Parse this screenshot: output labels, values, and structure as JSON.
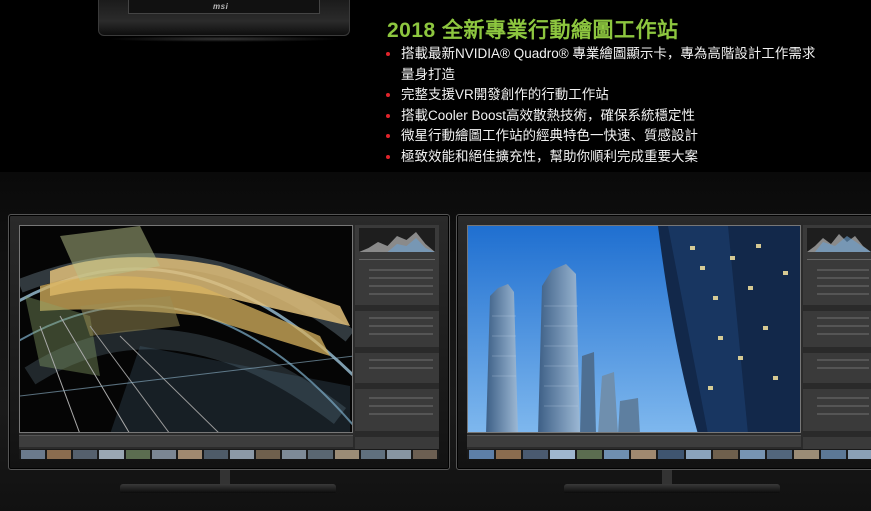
{
  "laptop": {
    "brand": "msi"
  },
  "headline": "2018 全新專業行動繪圖工作站",
  "features": [
    {
      "text": "搭載最新NVIDIA® Quadro® 專業繪圖顯示卡，專為高階設計工作需求量身打造"
    },
    {
      "text": "完整支援VR開發創作的行動工作站"
    },
    {
      "text": "搭載Cooler Boost高效散熱技術，確保系統穩定性"
    },
    {
      "text": "微星行動繪圖工作站的經典特色一快速、質感設計"
    },
    {
      "text": "極致效能和絕佳擴充性，幫助你順利完成重要大案"
    }
  ],
  "colors": {
    "headline": "#8dc63f",
    "bullet": "#e1242b",
    "background": "#000000"
  },
  "monitors": [
    {
      "content": "3d-architecture-wireframe"
    },
    {
      "content": "skyscrapers-photo"
    }
  ]
}
